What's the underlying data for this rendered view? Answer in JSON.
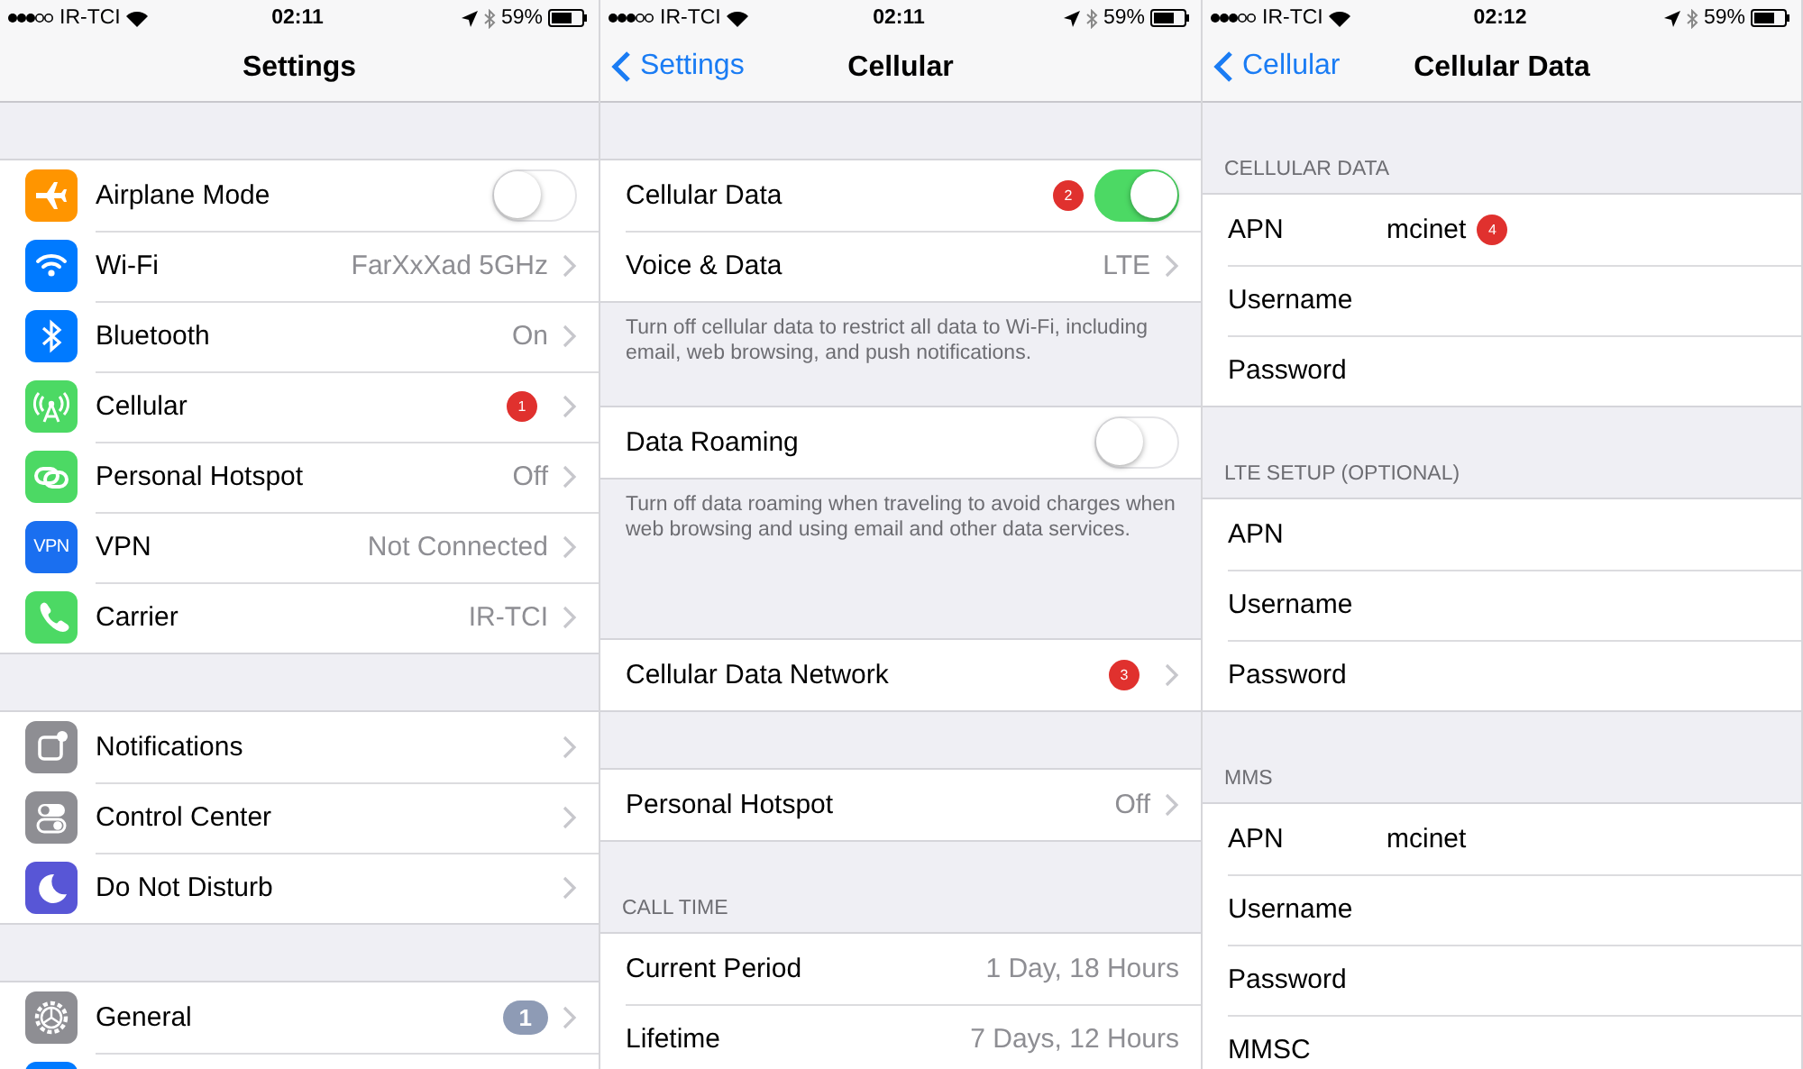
{
  "screens": [
    {
      "status_bar": {
        "carrier": "IR-TCI",
        "time": "02:11",
        "battery": "59%"
      },
      "nav": {
        "title": "Settings"
      },
      "sections": [
        {
          "kind": "spacer"
        },
        {
          "kind": "group",
          "rows": [
            {
              "kind": "toggle",
              "label": "Airplane Mode",
              "on": false
            },
            {
              "kind": "link",
              "label": "Wi-Fi",
              "value": "FarXxXad 5GHz"
            },
            {
              "kind": "link",
              "label": "Bluetooth",
              "value": "On"
            },
            {
              "kind": "link",
              "label": "Cellular",
              "marker": "1"
            },
            {
              "kind": "link",
              "label": "Personal Hotspot",
              "value": "Off"
            },
            {
              "kind": "link",
              "icon_text": "VPN",
              "label": "VPN",
              "value": "Not Connected"
            },
            {
              "kind": "link",
              "label": "Carrier",
              "value": "IR-TCI"
            }
          ]
        },
        {
          "kind": "spacer"
        },
        {
          "kind": "group",
          "rows": [
            {
              "kind": "link",
              "label": "Notifications"
            },
            {
              "kind": "link",
              "label": "Control Center"
            },
            {
              "kind": "link",
              "label": "Do Not Disturb"
            }
          ]
        },
        {
          "kind": "spacer"
        },
        {
          "kind": "group",
          "rows": [
            {
              "kind": "link",
              "label": "General",
              "badge": "1"
            },
            {
              "kind": "link"
            }
          ]
        }
      ]
    },
    {
      "status_bar": {
        "carrier": "IR-TCI",
        "time": "02:11",
        "battery": "59%"
      },
      "nav": {
        "back": "Settings",
        "title": "Cellular"
      },
      "sections": [
        {
          "kind": "spacer"
        },
        {
          "kind": "group",
          "rows": [
            {
              "kind": "toggle",
              "label": "Cellular Data",
              "on": true,
              "marker": "2"
            },
            {
              "kind": "link",
              "label": "Voice & Data",
              "value": "LTE"
            }
          ]
        },
        {
          "kind": "footer",
          "text": "Turn off cellular data to restrict all data to Wi-Fi, including email, web browsing, and push notifications."
        },
        {
          "kind": "group",
          "rows": [
            {
              "kind": "toggle",
              "label": "Data Roaming",
              "on": false
            }
          ]
        },
        {
          "kind": "footer",
          "text": "Turn off data roaming when traveling to avoid charges when web browsing and using email and other data services."
        },
        {
          "kind": "spacer"
        },
        {
          "kind": "group",
          "rows": [
            {
              "kind": "link",
              "label": "Cellular Data Network",
              "marker": "3"
            }
          ]
        },
        {
          "kind": "spacer"
        },
        {
          "kind": "group",
          "rows": [
            {
              "kind": "link",
              "label": "Personal Hotspot",
              "value": "Off"
            }
          ]
        },
        {
          "kind": "header",
          "text": "CALL TIME"
        },
        {
          "kind": "group",
          "rows": [
            {
              "kind": "info",
              "label": "Current Period",
              "value": "1 Day, 18 Hours"
            },
            {
              "kind": "info",
              "label": "Lifetime",
              "value": "7 Days, 12 Hours"
            }
          ]
        }
      ]
    },
    {
      "status_bar": {
        "carrier": "IR-TCI",
        "time": "02:12",
        "battery": "59%"
      },
      "nav": {
        "back": "Cellular",
        "title": "Cellular Data"
      },
      "sections": [
        {
          "kind": "header",
          "text": "CELLULAR DATA"
        },
        {
          "kind": "group",
          "rows": [
            {
              "kind": "field",
              "label": "APN",
              "value": "mcinet",
              "marker": "4"
            },
            {
              "kind": "field",
              "label": "Username"
            },
            {
              "kind": "field",
              "label": "Password"
            }
          ]
        },
        {
          "kind": "header",
          "text": "LTE SETUP (OPTIONAL)"
        },
        {
          "kind": "group",
          "rows": [
            {
              "kind": "field",
              "label": "APN"
            },
            {
              "kind": "field",
              "label": "Username"
            },
            {
              "kind": "field",
              "label": "Password"
            }
          ]
        },
        {
          "kind": "header",
          "text": "MMS"
        },
        {
          "kind": "group",
          "rows": [
            {
              "kind": "field",
              "label": "APN",
              "value": "mcinet"
            },
            {
              "kind": "field",
              "label": "Username"
            },
            {
              "kind": "field",
              "label": "Password"
            },
            {
              "kind": "field",
              "label": "MMSC"
            }
          ]
        }
      ]
    }
  ]
}
